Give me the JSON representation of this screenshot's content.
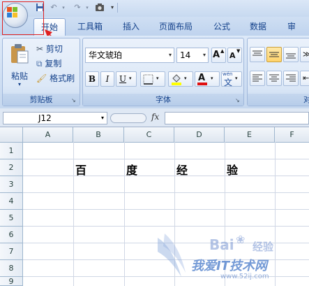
{
  "tabs": [
    {
      "label": "开始",
      "active": true
    },
    {
      "label": "工具箱"
    },
    {
      "label": "插入"
    },
    {
      "label": "页面布局"
    },
    {
      "label": "公式"
    },
    {
      "label": "数据"
    },
    {
      "label": "审阅"
    }
  ],
  "clipboard": {
    "paste_label": "粘贴",
    "cut_label": "剪切",
    "copy_label": "复制",
    "format_painter_label": "格式刷",
    "group_label": "剪贴板"
  },
  "font": {
    "font_name": "华文琥珀",
    "font_size": "14",
    "group_label": "字体",
    "grow_label": "A",
    "shrink_label": "A",
    "bold_label": "B",
    "italic_label": "I",
    "underline_label": "U",
    "color_label": "A",
    "phonetic_label": "文"
  },
  "alignment": {
    "group_label": "对"
  },
  "formula_bar": {
    "name_box": "J12",
    "fx_label": "fx",
    "content": ""
  },
  "sheet": {
    "columns": [
      "A",
      "B",
      "C",
      "D",
      "E",
      "F"
    ],
    "rows": [
      "1",
      "2",
      "3",
      "4",
      "5",
      "6",
      "7",
      "8",
      "9"
    ],
    "cells": {
      "B2": "百",
      "C2": "度",
      "D2": "经",
      "E2": "验"
    }
  },
  "watermark": {
    "brand": "Bai",
    "brand_suffix": "经验",
    "site_cn": "我爱IT技术网",
    "site_url": "www.52ij.com"
  },
  "colors": {
    "accent_red": "#e02020",
    "ribbon_blue": "#c6d8ef"
  }
}
